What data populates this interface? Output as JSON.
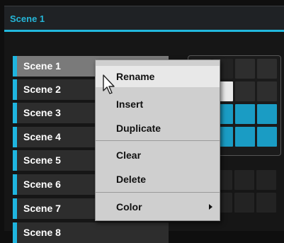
{
  "header": {
    "title": "Scene 1"
  },
  "scenes": [
    {
      "label": "Scene 1",
      "selected": true
    },
    {
      "label": "Scene 2",
      "selected": false
    },
    {
      "label": "Scene 3",
      "selected": false
    },
    {
      "label": "Scene 4",
      "selected": false
    },
    {
      "label": "Scene 5",
      "selected": false
    },
    {
      "label": "Scene 6",
      "selected": false
    },
    {
      "label": "Scene 7",
      "selected": false
    },
    {
      "label": "Scene 8",
      "selected": false
    }
  ],
  "context_menu": {
    "items": [
      {
        "label": "Rename",
        "hover": true
      },
      {
        "label": "Insert"
      },
      {
        "label": "Duplicate"
      },
      {
        "label": "Clear"
      },
      {
        "label": "Delete"
      },
      {
        "label": "Color",
        "has_submenu": true
      }
    ]
  },
  "colors": {
    "accent": "#1fb5df",
    "pad_active": "#1a9cc4",
    "menu_bg": "#cfcfcf",
    "menu_hover": "#e8e8e8"
  },
  "icons": {
    "cursor": "mouse-pointer-icon",
    "submenu": "triangle-right-icon"
  }
}
